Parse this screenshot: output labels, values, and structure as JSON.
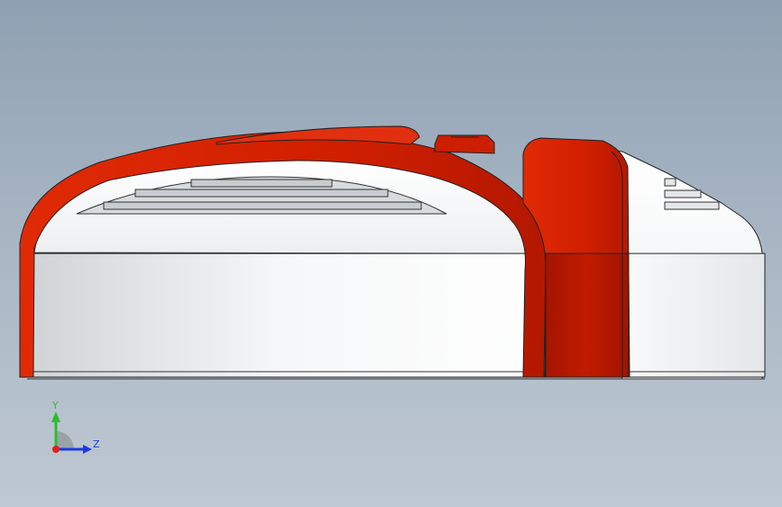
{
  "viewport": {
    "background_top": "#8fa0b2",
    "background_bottom": "#bec8d2"
  },
  "model": {
    "shell_color": "#ffffff",
    "trim_color": "#d21f00",
    "trim_shadow": "#a81500",
    "vent_color": "#c8ccd0"
  },
  "triad": {
    "y_label": "Y",
    "z_label": "Z",
    "y_color": "#2bbf2b",
    "z_color": "#1e3adf",
    "x_color": "#e02020"
  }
}
